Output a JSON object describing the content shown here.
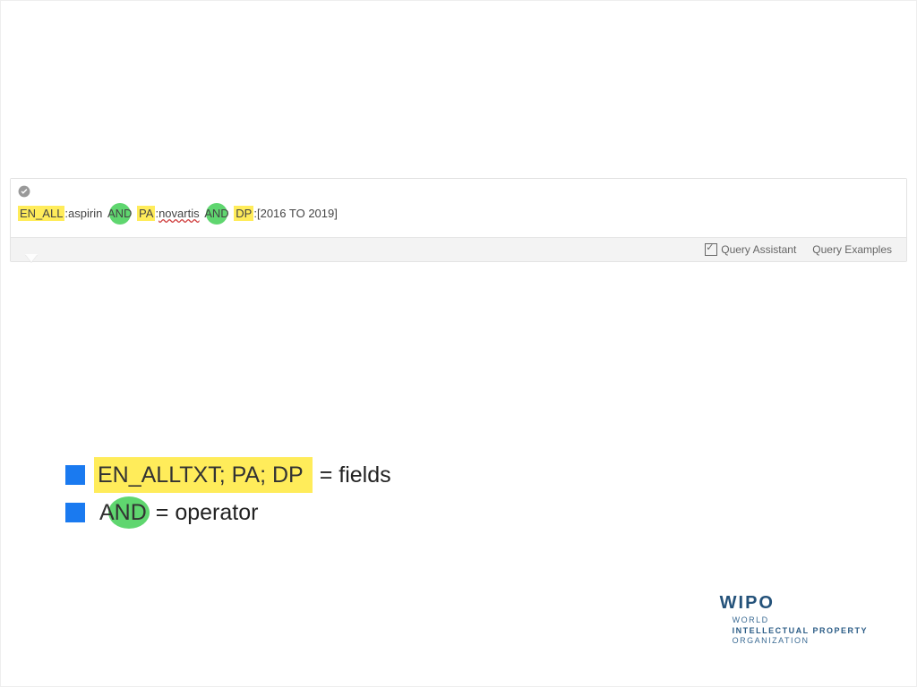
{
  "query": {
    "field1": "EN_ALL",
    "sep1": ":",
    "term1": "aspirin",
    "op1": "AND",
    "field2": "PA",
    "sep2": ":",
    "term2": "novartis",
    "op2": "AND",
    "field3": "DP",
    "sep3": ":",
    "range": "[2016 TO 2019]"
  },
  "footer": {
    "assistant": "Query Assistant",
    "examples": "Query Examples"
  },
  "legend": {
    "fields_text": "EN_ALLTXT; PA; DP",
    "fields_label": "= fields",
    "and_text": "AND",
    "operator_label": "= operator"
  },
  "logo": {
    "wipo": "WIPO",
    "line1": "WORLD",
    "line2": "INTELLECTUAL PROPERTY",
    "line3": "ORGANIZATION"
  }
}
